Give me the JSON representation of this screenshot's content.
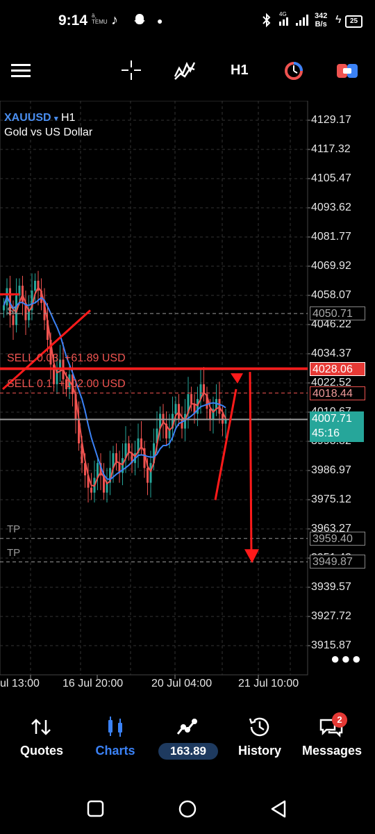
{
  "status_bar": {
    "time": "9:14",
    "mini_label_top": "ä¸",
    "mini_label_bottom": "TEMU",
    "net_speed_value": "342",
    "net_speed_unit": "B/s",
    "network": "4G",
    "battery": "25"
  },
  "toolbar": {
    "timeframe": "H1",
    "icons": [
      "menu-icon",
      "crosshair-icon",
      "indicators-icon",
      "timeframe-button",
      "one-click-trading-icon",
      "trade-toggle-icon"
    ]
  },
  "chart": {
    "symbol": "XAUUSD",
    "symbol_arrow": "▾",
    "timeframe": "H1",
    "description": "Gold vs US Dollar",
    "price_labels": [
      "4129.17",
      "4117.32",
      "4105.47",
      "4093.62",
      "4081.77",
      "4069.92",
      "4058.07",
      "4046.22",
      "4034.37",
      "4022.52",
      "4010.67",
      "3998.82",
      "3986.97",
      "3975.12",
      "3963.27",
      "3951.42",
      "3939.57",
      "3927.72",
      "3915.87"
    ],
    "time_labels": [
      "ul 13:00",
      "16 Jul 20:00",
      "20 Jul 04:00",
      "21 Jul 10:00"
    ],
    "orders": [
      {
        "label": "SELL 0.03, +61.89 USD",
        "price": "4050.71"
      },
      {
        "label": "SELL 0.1, +102.00 USD",
        "price": "4018.44"
      }
    ],
    "sl_label": "SL",
    "tp_labels": [
      "TP",
      "TP"
    ],
    "tp_prices": [
      "3959.40",
      "3949.87"
    ],
    "sl_price": "4050.71",
    "current_line_price": "4028.06",
    "bid_price": "4007.71",
    "countdown": "45:16",
    "more_glyph": "●●●",
    "colors": {
      "bull": "#26a69a",
      "bear": "#ef5350",
      "ma_fast": "#ef5350",
      "ma_slow": "#3b82f6",
      "annotation": "#ff1a1a",
      "bid_box": "#26a69a"
    }
  },
  "bottom_nav": {
    "items": [
      {
        "label": "Quotes",
        "icon": "quotes-icon"
      },
      {
        "label": "Charts",
        "icon": "charts-icon",
        "active": true
      },
      {
        "label": "163.89",
        "icon": "trade-icon"
      },
      {
        "label": "History",
        "icon": "history-icon"
      },
      {
        "label": "Messages",
        "icon": "messages-icon"
      }
    ],
    "messages_badge": "2"
  }
}
